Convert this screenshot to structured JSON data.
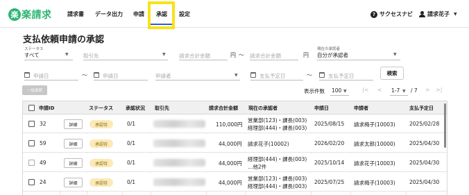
{
  "header": {
    "logo_mark": "楽",
    "logo_text": "楽請求",
    "nav": [
      "請求書",
      "データ出力",
      "申請",
      "承認",
      "設定"
    ],
    "active_nav": "承認",
    "help_label": "サクセスナビ",
    "help_icon": "help-circle-icon",
    "user_name": "請求花子",
    "user_icon": "user-icon"
  },
  "page": {
    "title": "支払依頼申請の承認"
  },
  "filters": {
    "status_label": "ステータス",
    "status_value": "すべて",
    "partner_placeholder": "取引先",
    "amount_min_placeholder": "請求合計金額",
    "amount_max_placeholder": "請求合計金額",
    "yen": "円",
    "range_sep": "〜",
    "approver_label": "現在の承認者",
    "approver_value": "自分が承認者",
    "apply_from_placeholder": "申請日",
    "apply_to_placeholder": "申請日",
    "applicant_placeholder": "申請者",
    "pay_from_placeholder": "支払予定日",
    "pay_to_placeholder": "支払予定日",
    "search_button": "検索"
  },
  "toolbar": {
    "bulk_approve": "一括承認",
    "rows_label": "表示件数",
    "rows_value": "100",
    "page_range": "1-7",
    "page_total": "/ 7"
  },
  "table": {
    "columns": [
      "申請ID",
      "ステータス",
      "承認状況",
      "取引先",
      "請求合計金額",
      "現在の承認者",
      "申請日",
      "申請者",
      "支払予定日"
    ],
    "detail_label": "詳細",
    "rows": [
      {
        "id": "32",
        "status": "承認待",
        "progress": "0/1",
        "amount": "110,000円",
        "approver_1": "営業部(123)・課長(003)",
        "approver_2": "経理部(444)・課長(003)",
        "applied": "2025/08/15",
        "applicant": "請求梅子(10003)",
        "pay_date": "2025/02/28"
      },
      {
        "id": "59",
        "status": "承認待",
        "progress": "0/1",
        "amount": "44,000円",
        "approver_1": "請求花子(10002)",
        "approver_2": "",
        "applied": "2026/02/20",
        "applicant": "請求太郎(10000)",
        "pay_date": "2025/04/30"
      },
      {
        "id": "49",
        "status": "承認待",
        "progress": "0/1",
        "amount": "44,000円",
        "approver_1": "経理部(444)・課長(003)",
        "approver_2": "…他2件",
        "applied": "2025/10/14",
        "applicant": "請求花子(10003)",
        "pay_date": "2025/04/30"
      },
      {
        "id": "24",
        "status": "承認待",
        "progress": "0/1",
        "amount": "44,000円",
        "approver_1": "営業部(123)・課長(003)",
        "approver_2": "経理部(444)・課長(003)",
        "applied": "2025/07/25",
        "applicant": "請求梅子(10003)",
        "pay_date": "2025/04/30"
      }
    ]
  },
  "colors": {
    "brand": "#2bb573",
    "highlight": "#f7e21a",
    "active_underline": "#2b5fc7",
    "badge_bg": "#fbe9b7"
  }
}
